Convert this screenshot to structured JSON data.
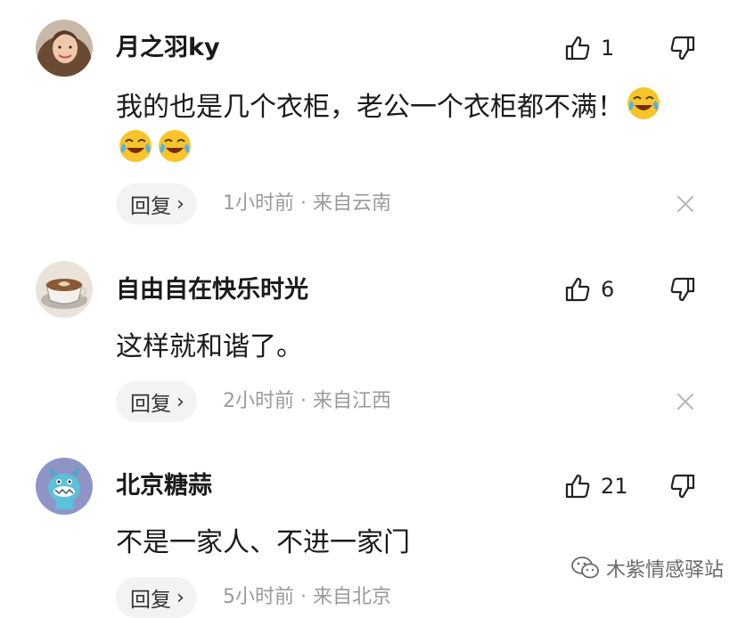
{
  "comments": [
    {
      "username": "月之羽ky",
      "likes": "1",
      "text_line1": "我的也是几个衣柜，老公一个衣柜都不满！",
      "emojis_line1": [
        "crying-laughing-emoji"
      ],
      "emojis_line2": [
        "crying-laughing-emoji",
        "crying-laughing-emoji"
      ],
      "reply_label": "回复",
      "meta": "1小时前 · 来自云南",
      "avatar": "woman-photo-avatar"
    },
    {
      "username": "自由自在快乐时光",
      "likes": "6",
      "text_line1": "这样就和谐了。",
      "reply_label": "回复",
      "meta": "2小时前 · 来自江西",
      "avatar": "coffee-cup-avatar"
    },
    {
      "username": "北京糖蒜",
      "likes": "21",
      "text_line1": "不是一家人、不进一家门",
      "reply_label": "回复",
      "meta": "5小时前 · 来自北京",
      "avatar": "cartoon-monster-avatar"
    }
  ],
  "watermark": {
    "text": "木紫情感驿站",
    "icon": "wechat-icon"
  },
  "colors": {
    "meta_text": "#9a9a9a",
    "reply_bg": "#f3f3f3",
    "emoji_yellow": "#f7c52b"
  }
}
